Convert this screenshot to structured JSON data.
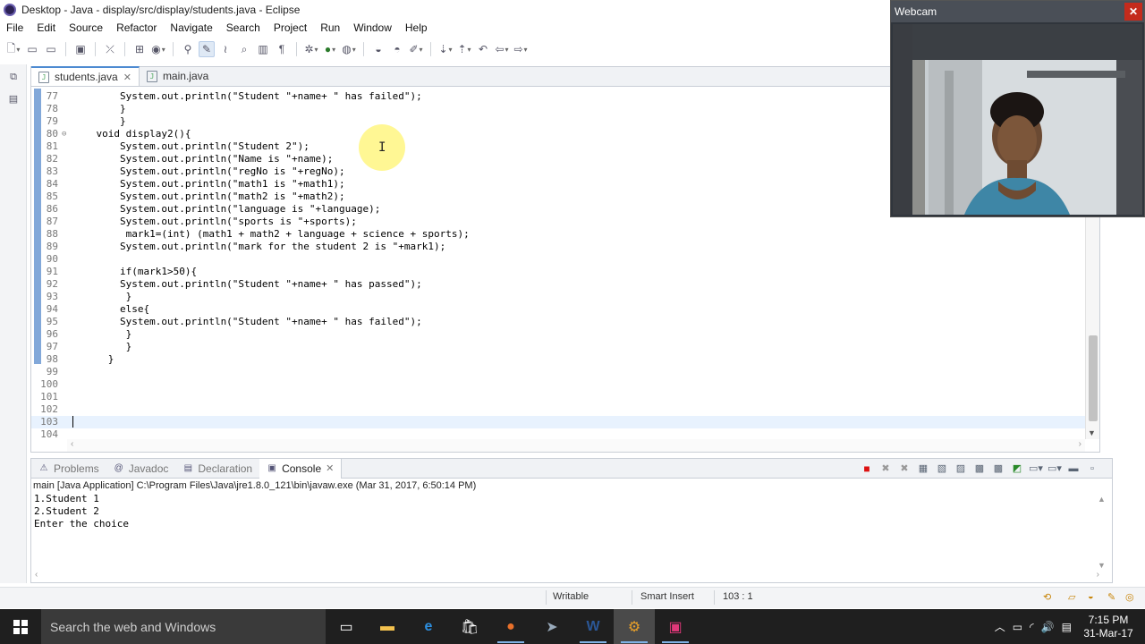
{
  "window": {
    "title": "Desktop - Java - display/src/display/students.java - Eclipse"
  },
  "menubar": [
    "File",
    "Edit",
    "Source",
    "Refactor",
    "Navigate",
    "Search",
    "Project",
    "Run",
    "Window",
    "Help"
  ],
  "editor": {
    "tabs": [
      {
        "label": "students.java",
        "active": true,
        "closable": true
      },
      {
        "label": "main.java",
        "active": false,
        "closable": false
      }
    ],
    "lines": [
      {
        "n": "77",
        "code": "        System.out.println(\"Student \"+name+ \" has failed\");"
      },
      {
        "n": "78",
        "code": "        }"
      },
      {
        "n": "79",
        "code": "        }"
      },
      {
        "n": "80",
        "code": "    void display2(){",
        "fold": "⊖"
      },
      {
        "n": "81",
        "code": "        System.out.println(\"Student 2\");"
      },
      {
        "n": "82",
        "code": "        System.out.println(\"Name is \"+name);"
      },
      {
        "n": "83",
        "code": "        System.out.println(\"regNo is \"+regNo);"
      },
      {
        "n": "84",
        "code": "        System.out.println(\"math1 is \"+math1);"
      },
      {
        "n": "85",
        "code": "        System.out.println(\"math2 is \"+math2);"
      },
      {
        "n": "86",
        "code": "        System.out.println(\"language is \"+language);"
      },
      {
        "n": "87",
        "code": "        System.out.println(\"sports is \"+sports);"
      },
      {
        "n": "88",
        "code": "         mark1=(int) (math1 + math2 + language + science + sports);"
      },
      {
        "n": "89",
        "code": "        System.out.println(\"mark for the student 2 is \"+mark1);"
      },
      {
        "n": "90",
        "code": ""
      },
      {
        "n": "91",
        "code": "        if(mark1>50){"
      },
      {
        "n": "92",
        "code": "        System.out.println(\"Student \"+name+ \" has passed\");"
      },
      {
        "n": "93",
        "code": "         }"
      },
      {
        "n": "94",
        "code": "        else{"
      },
      {
        "n": "95",
        "code": "        System.out.println(\"Student \"+name+ \" has failed\");"
      },
      {
        "n": "96",
        "code": "         }"
      },
      {
        "n": "97",
        "code": "         }"
      },
      {
        "n": "98",
        "code": "      }"
      },
      {
        "n": "99",
        "code": ""
      },
      {
        "n": "100",
        "code": ""
      },
      {
        "n": "101",
        "code": ""
      },
      {
        "n": "102",
        "code": ""
      },
      {
        "n": "103",
        "code": "",
        "current": true
      },
      {
        "n": "104",
        "code": ""
      }
    ]
  },
  "console": {
    "tabs": [
      {
        "label": "Problems",
        "icon": "problems-icon",
        "glyph": "⚠",
        "active": false
      },
      {
        "label": "Javadoc",
        "icon": "javadoc-icon",
        "glyph": "@",
        "active": false
      },
      {
        "label": "Declaration",
        "icon": "declaration-icon",
        "glyph": "▤",
        "active": false
      },
      {
        "label": "Console",
        "icon": "console-icon",
        "glyph": "▣",
        "active": true
      }
    ],
    "description": "main [Java Application] C:\\Program Files\\Java\\jre1.8.0_121\\bin\\javaw.exe (Mar 31, 2017, 6:50:14 PM)",
    "output": [
      "1.Student 1",
      "2.Student 2",
      "Enter the choice"
    ]
  },
  "statusbar": {
    "writable": "Writable",
    "insert_mode": "Smart Insert",
    "position": "103 : 1"
  },
  "webcam": {
    "title": "Webcam",
    "close": "✕"
  },
  "taskbar": {
    "search_placeholder": "Search the web and Windows",
    "time": "7:15 PM",
    "date": "31-Mar-17"
  }
}
